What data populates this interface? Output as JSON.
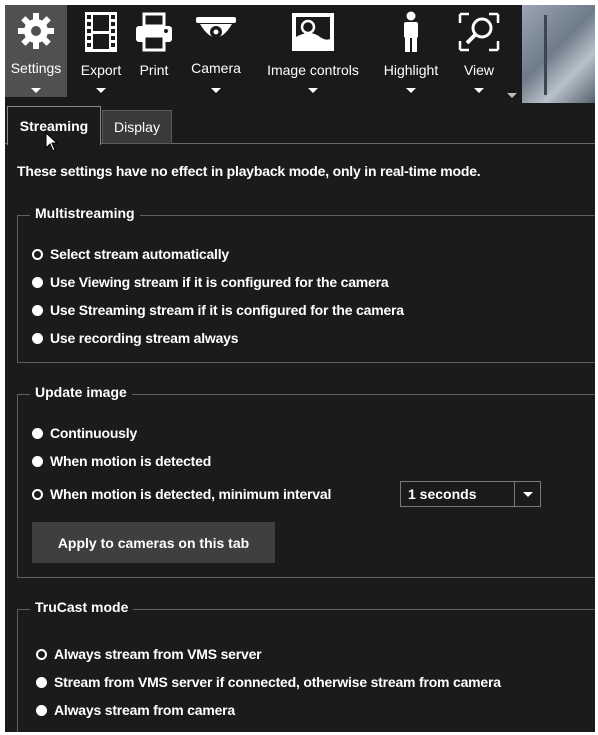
{
  "toolbar": {
    "settings": {
      "label": "Settings",
      "icon": "gear-icon"
    },
    "export": {
      "label": "Export",
      "icon": "film-icon"
    },
    "print": {
      "label": "Print",
      "icon": "printer-icon"
    },
    "camera": {
      "label": "Camera",
      "icon": "dome-camera-icon"
    },
    "image_controls": {
      "label": "Image controls",
      "icon": "image-icon"
    },
    "highlight": {
      "label": "Highlight",
      "icon": "person-icon"
    },
    "view": {
      "label": "View",
      "icon": "magnifier-icon"
    }
  },
  "tabs": [
    {
      "label": "Streaming",
      "active": true
    },
    {
      "label": "Display",
      "active": false
    }
  ],
  "notice": "These settings have no effect in playback mode, only in real-time mode.",
  "multistreaming": {
    "title": "Multistreaming",
    "options": [
      {
        "label": "Select stream automatically",
        "selected": true
      },
      {
        "label": "Use Viewing stream if it is configured for the camera",
        "selected": false
      },
      {
        "label": "Use Streaming stream if it is configured for the camera",
        "selected": false
      },
      {
        "label": "Use recording stream always",
        "selected": false
      }
    ]
  },
  "update_image": {
    "title": "Update image",
    "options": [
      {
        "label": "Continuously",
        "selected": false
      },
      {
        "label": "When motion is detected",
        "selected": false
      },
      {
        "label": "When motion is detected, minimum interval",
        "selected": true
      }
    ],
    "interval": {
      "value": "1 seconds"
    },
    "apply_label": "Apply to cameras on this tab"
  },
  "trucast": {
    "title": "TruCast mode",
    "options": [
      {
        "label": "Always stream from VMS server",
        "selected": true
      },
      {
        "label": "Stream from VMS server if connected, otherwise stream from camera",
        "selected": false
      },
      {
        "label": "Always stream from camera",
        "selected": false
      }
    ]
  },
  "colors": {
    "background": "#1b1b1b",
    "text": "#ffffff",
    "active_tool": "#505050",
    "button": "#3f3f3f"
  }
}
